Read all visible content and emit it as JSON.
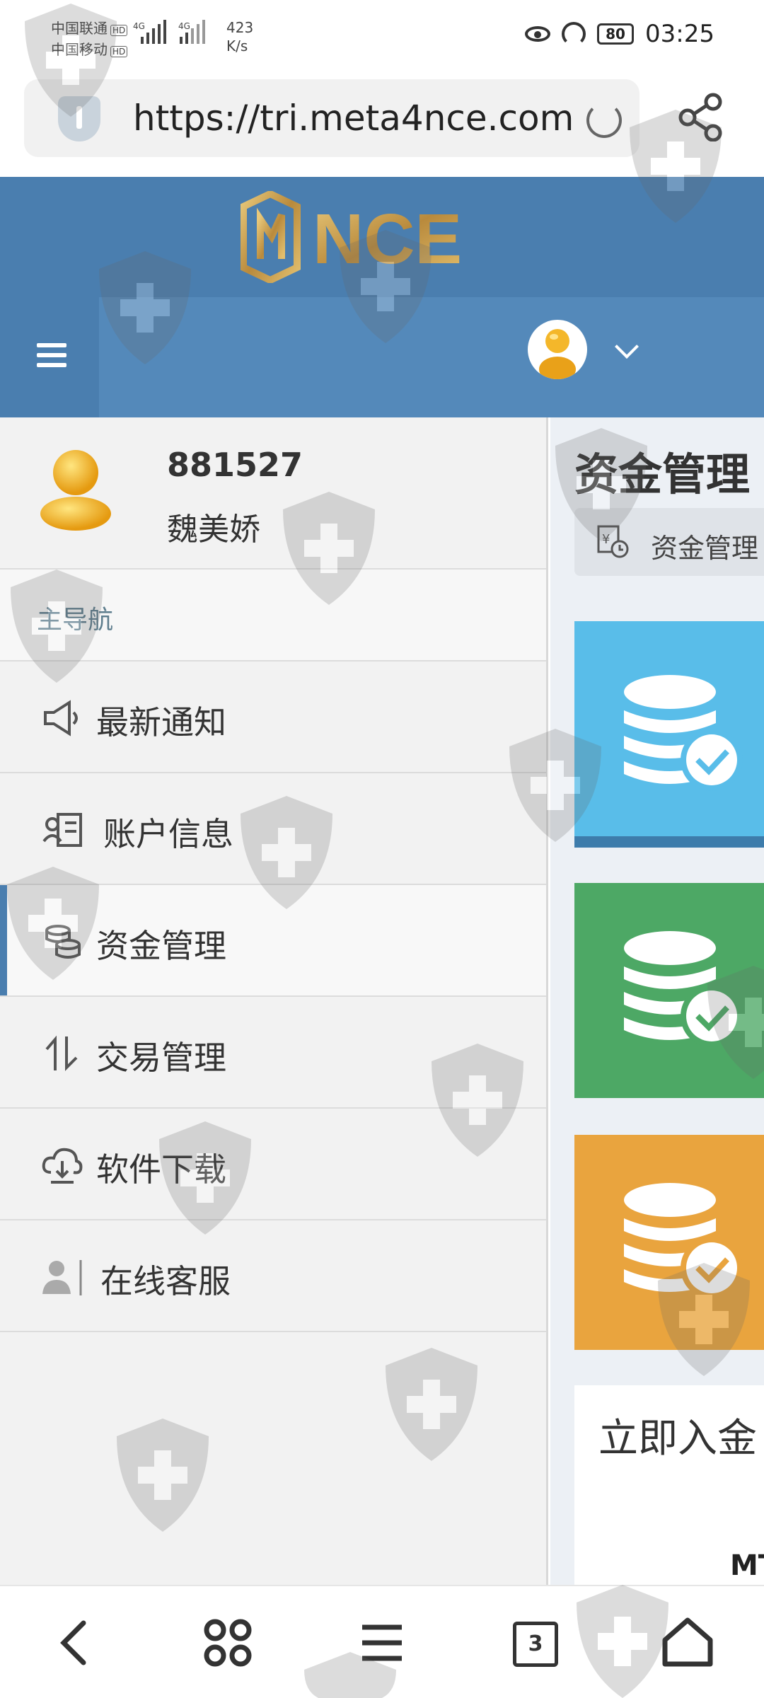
{
  "status_bar": {
    "carrier1": "中国联通",
    "carrier2": "中国移动",
    "hd_label": "HD",
    "net_type": "4G",
    "net_speed_value": "423",
    "net_speed_unit": "K/s",
    "battery": "80",
    "time": "03:25"
  },
  "browser": {
    "url": "https://tri.meta4nce.com",
    "tab_count": "3"
  },
  "header": {
    "logo_text": "NCE"
  },
  "sidebar": {
    "user_id": "881527",
    "user_name": "魏美娇",
    "nav_header": "主导航",
    "items": [
      {
        "label": "最新通知",
        "icon": "megaphone-icon"
      },
      {
        "label": "账户信息",
        "icon": "id-card-icon"
      },
      {
        "label": "资金管理",
        "icon": "coins-icon",
        "active": true
      },
      {
        "label": "交易管理",
        "icon": "exchange-icon"
      },
      {
        "label": "软件下载",
        "icon": "cloud-download-icon"
      },
      {
        "label": "在线客服",
        "icon": "user-icon"
      }
    ]
  },
  "content": {
    "page_title": "资金管理",
    "breadcrumb": "资金管理",
    "cards": [
      {
        "color": "#59bde9",
        "icon": "database-check-icon"
      },
      {
        "color": "#4da865",
        "icon": "database-check-icon"
      },
      {
        "color": "#e9a43e",
        "icon": "database-check-icon"
      }
    ],
    "deposit_title": "立即入金",
    "deposit_sub": "MT"
  },
  "colors": {
    "header": "#4a7eaf",
    "nav_strip": "#5489ba",
    "logo_gold": "#c9a25a"
  }
}
